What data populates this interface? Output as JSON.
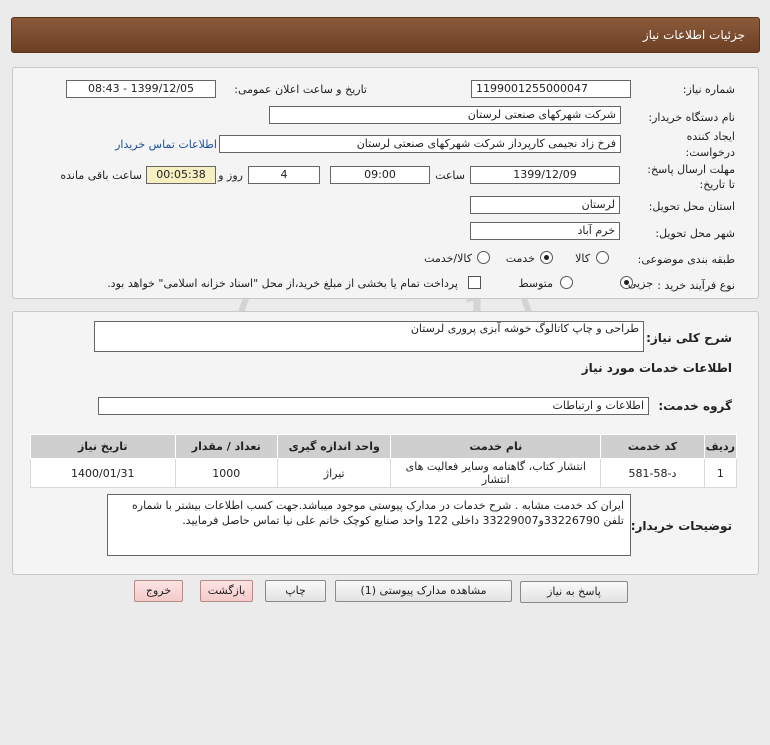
{
  "header": {
    "title": "جزئیات اطلاعات نیاز"
  },
  "form": {
    "need_number_label": "شماره نیاز:",
    "need_number": "1199001255000047",
    "announce_label": "تاریخ و ساعت اعلان عمومی:",
    "announce_value": "1399/12/05 - 08:43",
    "buyer_org_label": "نام دستگاه خریدار:",
    "buyer_org": "شرکت شهرکهای صنعتی لرستان",
    "creator_label_1": "ایجاد کننده",
    "creator_label_2": "درخواست:",
    "creator": "فرخ زاد نجیمی کارپرداز شرکت شهرکهای صنعتی لرستان",
    "contact_link": "اطلاعات تماس خریدار",
    "deadline_label_1": "مهلت ارسال پاسخ:",
    "deadline_label_2": "تا تاریخ:",
    "deadline_date": "1399/12/09",
    "time_label": "ساعت",
    "deadline_time": "09:00",
    "days": "4",
    "days_label": "روز و",
    "remaining": "00:05:38",
    "remaining_label": "ساعت باقی مانده",
    "province_label": "استان محل تحویل:",
    "province": "لرستان",
    "city_label": "شهر محل تحویل:",
    "city": "خرم آباد",
    "category_label": "طبقه بندی موضوعی:",
    "category_options": [
      "کالا",
      "خدمت",
      "کالا/خدمت"
    ],
    "category_selected": 1,
    "process_label": "نوع فرآیند خرید :",
    "process_options": [
      "جزیی",
      "متوسط"
    ],
    "process_selected": 0,
    "treasury_note": "پرداخت تمام یا بخشی از مبلغ خرید،از محل \"اسناد خزانه اسلامی\" خواهد بود."
  },
  "desc": {
    "label": "شرح کلی نیاز:",
    "value": "طراحی و چاپ کاتالوگ خوشه آبزی پروری لرستان"
  },
  "services_info_title": "اطلاعات خدمات مورد نیاز",
  "service_group": {
    "label": "گروه خدمت:",
    "value": "اطلاعات و ارتباطات"
  },
  "table": {
    "headers": [
      "ردیف",
      "کد خدمت",
      "نام خدمت",
      "واحد اندازه گیری",
      "تعداد / مقدار",
      "تاریخ نیاز"
    ],
    "rows": [
      [
        "1",
        "د-58-581",
        "انتشار کتاب، گاهنامه وسایر فعالیت های انتشار",
        "تیراژ",
        "1000",
        "1400/01/31"
      ]
    ]
  },
  "buyer_notes": {
    "label": "توضیحات خریدار:",
    "value": "ایران کد خدمت مشابه . شرح خدمات در مدارک پیوستی موجود میباشد.جهت کسب اطلاعات بیشتر با شماره تلفن 33226790و33229007 داخلی 122 واحد صنایع کوچک خانم علی نیا تماس حاصل فرمایید."
  },
  "buttons": {
    "reply": "پاسخ به نیاز",
    "attachments": "مشاهده مدارک پیوستی (1)",
    "print": "چاپ",
    "back": "بازگشت",
    "exit": "خروج"
  },
  "colors": {
    "header_bg": "#6d4024",
    "link": "#1d4fa0",
    "table_header": "#cfcfcf"
  }
}
